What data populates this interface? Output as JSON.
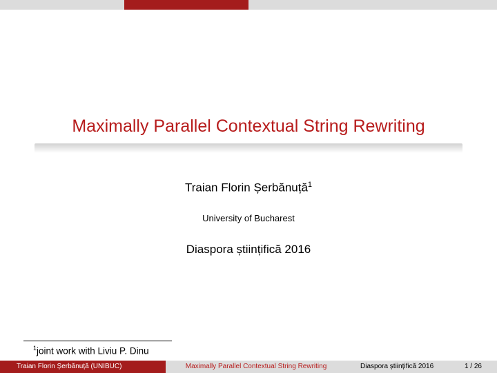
{
  "topbar": {},
  "title": "Maximally Parallel Contextual String Rewriting",
  "author": "Traian Florin Șerbănuță",
  "author_sup": "1",
  "affiliation": "University of Bucharest",
  "event": "Diaspora științifică 2016",
  "footnote_sup": "1",
  "footnote_text": "joint work with Liviu P. Dinu",
  "footer": {
    "left": "Traian Florin Șerbănuță  (UNIBUC)",
    "mid": "Maximally Parallel Contextual String Rewriting",
    "right_event": "Diaspora științifică 2016",
    "page": "1 / 26"
  }
}
